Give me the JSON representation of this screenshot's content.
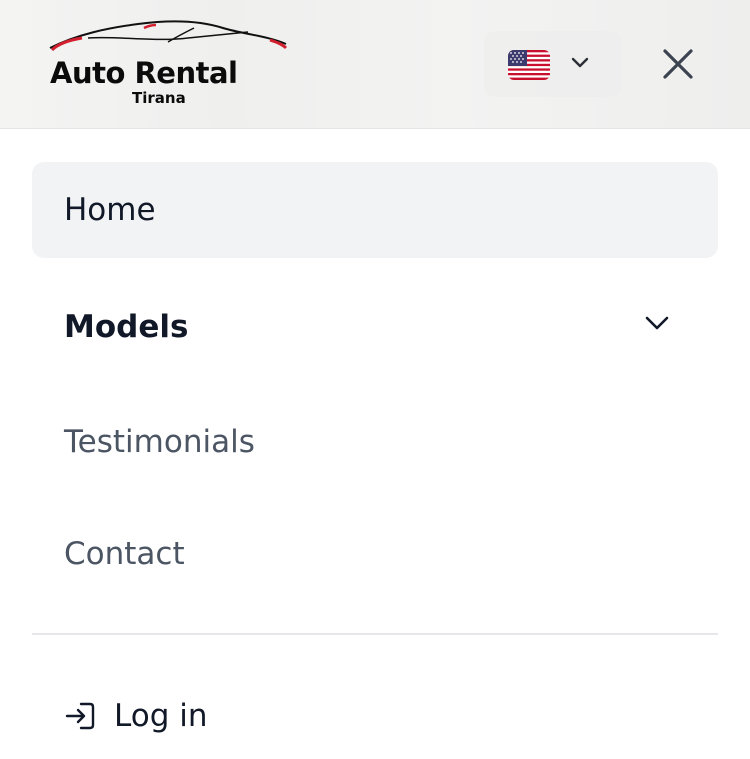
{
  "header": {
    "logo_title": "Auto Rental",
    "logo_subtitle": "Tirana",
    "language": {
      "flag_icon": "us-flag-icon",
      "chevron_icon": "chevron-down-icon"
    },
    "close_icon": "close-icon"
  },
  "menu": {
    "items": [
      {
        "label": "Home",
        "active": true
      },
      {
        "label": "Models",
        "expandable": true
      },
      {
        "label": "Testimonials"
      },
      {
        "label": "Contact"
      }
    ]
  },
  "footer": {
    "login_label": "Log in",
    "login_icon": "login-icon"
  },
  "colors": {
    "text_primary": "#111827",
    "text_secondary": "#4b5563",
    "active_bg": "#f2f3f5",
    "divider": "#e5e7eb",
    "logo_accent": "#d3202f"
  }
}
